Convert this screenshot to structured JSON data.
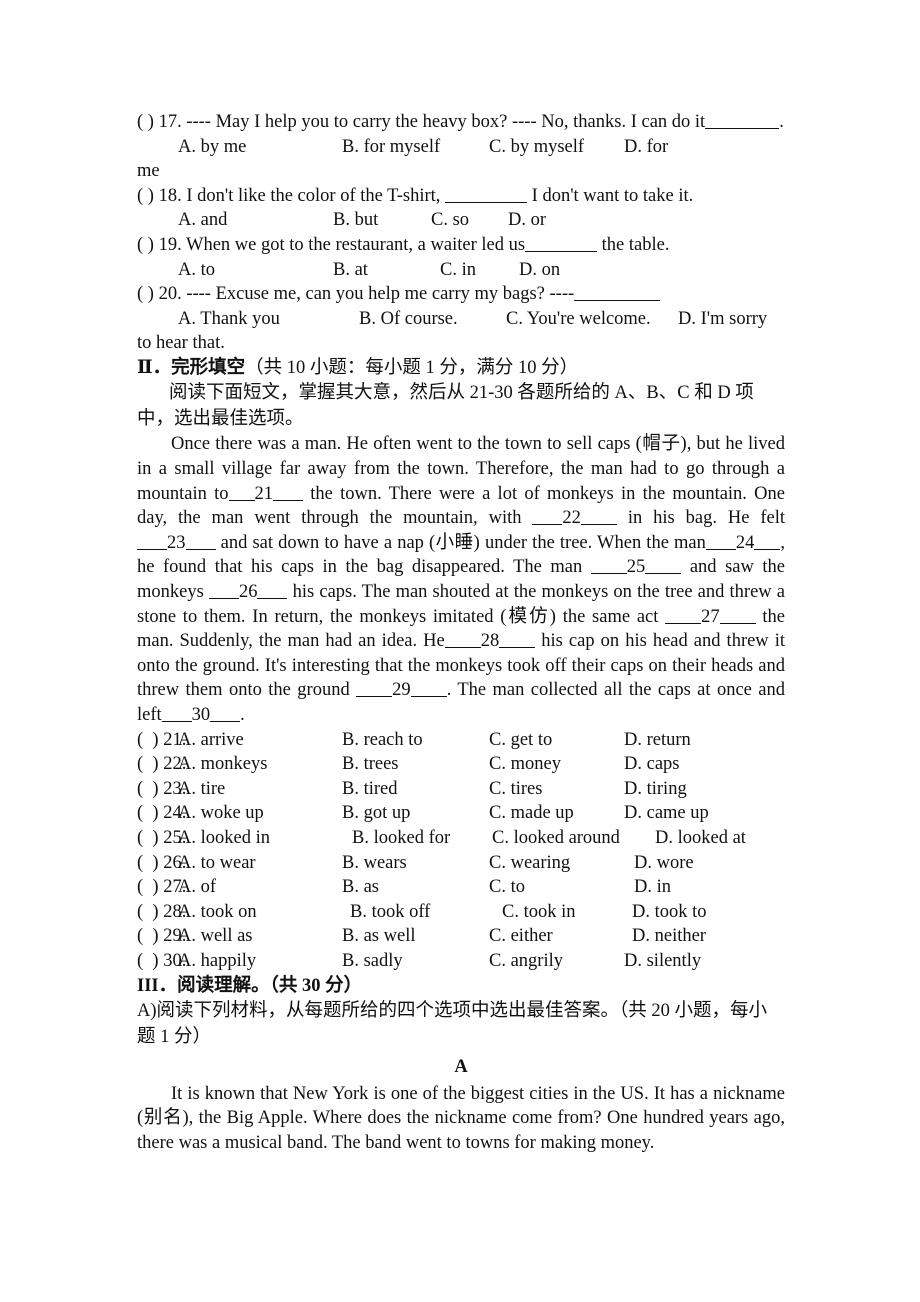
{
  "document": {
    "type": "english-exam-worksheet"
  },
  "section_single_choice": {
    "q17": {
      "tag": "(  ) 17.",
      "prompt_left": "---- May I help you to carry the heavy box?",
      "prompt_gap": "        ",
      "prompt_right": "---- No, thanks. I can do it",
      "trailing": ".",
      "options": {
        "a": "A. by me",
        "b": "B. for myself",
        "c": "C. by myself",
        "d": "D. for"
      },
      "wrap": "me"
    },
    "q18": {
      "tag": "(  ) 18.",
      "prompt_left": "I don't like the color of the T-shirt,",
      "prompt_right": "I don't want to take it.",
      "options": {
        "a": "A. and",
        "b": "B. but",
        "c": "C. so",
        "d": "D. or"
      }
    },
    "q19": {
      "tag": "(  ) 19.",
      "prompt_left": "When we got to the restaurant, a waiter led us",
      "prompt_right": "the table.",
      "options": {
        "a": "A. to",
        "b": "B. at",
        "c": "C. in",
        "d": "D. on"
      }
    },
    "q20": {
      "tag": "(  ) 20.",
      "prompt_left": "---- Excuse me, can you help me carry my bags?",
      "prompt_gap": "        ",
      "prompt_right": "----",
      "options": {
        "a": "A. Thank you",
        "b": "B. Of course.",
        "c": "C. You're welcome.",
        "d": "D. I'm sorry"
      },
      "wrap": "to hear that."
    }
  },
  "section_cloze": {
    "heading_bold": "Ⅱ．完形填空",
    "heading_rest": "（共 10 小题：每小题 1 分，满分 10 分）",
    "instruction": "阅读下面短文，掌握其大意，然后从 21-30 各题所给的 A、B、C 和 D 项中，选出最佳选项。",
    "passage_parts": {
      "p1": "Once there was a man. He often went to the town to sell caps (帽子), but he lived in a small village far away from the town. Therefore, the man had to go through a mountain to",
      "n21": "21",
      "p2": "the town. There were a lot of monkeys in the mountain. One day, the man went through the mountain, with",
      "n22": "22",
      "p3": "in his bag. He felt",
      "n23": "23",
      "p4": "and sat down to have a nap (小睡) under the tree. When the man",
      "n24": "24",
      "p5": ", he found that his caps in the bag disappeared. The man",
      "n25": "25",
      "p6": "and saw the monkeys",
      "n26": "26",
      "p7": "his caps. The man shouted at the monkeys on the tree and threw a stone to them. In return, the monkeys imitated (模仿) the same act",
      "n27": "27",
      "p8": "the man. Suddenly, the man had an idea. He",
      "n28": "28",
      "p9": "his cap on his head and threw it onto the ground. It's interesting that the monkeys took off their caps on their heads and threw them onto the ground",
      "n29": "29",
      "p10": ". The man collected all the caps at once and left",
      "n30": "30",
      "p11": "."
    },
    "questions": [
      {
        "tag": "(  ) 21.",
        "a": "A. arrive",
        "b": "B. reach to",
        "c": "C. get to",
        "d": "D. return"
      },
      {
        "tag": "(  ) 22.",
        "a": "A. monkeys",
        "b": "B. trees",
        "c": "C. money",
        "d": "D. caps"
      },
      {
        "tag": "(  ) 23.",
        "a": "A. tire",
        "b": "B. tired",
        "c": "C. tires",
        "d": "D. tiring"
      },
      {
        "tag": "(  ) 24.",
        "a": "A. woke up",
        "b": "B. got up",
        "c": "C. made up",
        "d": "D. came up"
      },
      {
        "tag": "(  ) 25.",
        "a": "A. looked in",
        "b": "B. looked for",
        "c": "C. looked around",
        "d": "D. looked at"
      },
      {
        "tag": "(  ) 26.",
        "a": "A. to wear",
        "b": "B. wears",
        "c": "C. wearing",
        "d": "D. wore"
      },
      {
        "tag": "(  ) 27.",
        "a": "A. of",
        "b": "B. as",
        "c": "C. to",
        "d": "D. in"
      },
      {
        "tag": "(  ) 28.",
        "a": "A. took on",
        "b": "B. took off",
        "c": "C. took in",
        "d": "D. took to"
      },
      {
        "tag": "(  ) 29.",
        "a": "A. well as",
        "b": "B. as well",
        "c": "C. either",
        "d": "D. neither"
      },
      {
        "tag": "(  ) 30.",
        "a": "A. happily",
        "b": "B. sadly",
        "c": "C. angrily",
        "d": "D. silently"
      }
    ]
  },
  "section_reading": {
    "heading_bold": "III．阅读理解。",
    "heading_rest": "（共 30 分）",
    "instruction": "A)阅读下列材料，从每题所给的四个选项中选出最佳答案。（共 20 小题，每小题 1 分）",
    "passage_label": "A",
    "passage_text": "It is known that New York is one of the biggest cities in the US. It has a nickname (别名), the Big Apple. Where does the nickname come from? One hundred years ago, there was a musical band. The band went to towns for making money."
  }
}
